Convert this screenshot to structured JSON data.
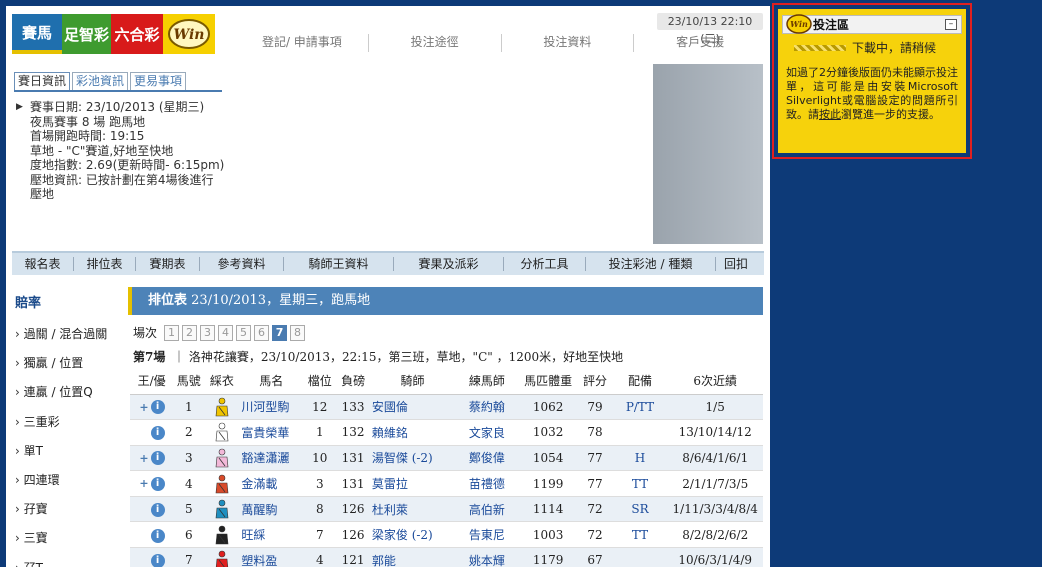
{
  "brand_tabs": [
    "賽馬",
    "足智彩",
    "六合彩",
    "Win"
  ],
  "datetime": "23/10/13 22:10 (三)",
  "top_links": [
    "登記/ 申請事項",
    "投注途徑",
    "投注資料",
    "客戶支援"
  ],
  "info_tabs": [
    "賽日資訊",
    "彩池資訊",
    "更易事項"
  ],
  "race_info_lines": [
    "賽事日期: 23/10/2013 (星期三)",
    "夜馬賽事 8 場 跑馬地",
    "首場開跑時間: 19:15",
    "草地 - \"C\"賽道,好地至快地",
    "度地指數: 2.69(更新時間- 6:15pm)",
    "壓地資訊: 已按計劃在第4場後進行",
    "壓地"
  ],
  "menu": [
    "報名表",
    "排位表",
    "賽期表",
    "參考資料",
    "騎師王資料",
    "賽果及派彩",
    "分析工具",
    "投注彩池 / 種類",
    "回扣"
  ],
  "left_nav": {
    "title": "賠率",
    "items": [
      "過關 / 混合過關",
      "獨贏 / 位置",
      "連贏 / 位置Q",
      "三重彩",
      "單T",
      "四連環",
      "孖寶",
      "三寶",
      "孖T"
    ]
  },
  "race_card": {
    "title_bold": "排位表",
    "title_rest": " 23/10/2013，星期三，跑馬地",
    "race_label": "場次",
    "races": [
      "1",
      "2",
      "3",
      "4",
      "5",
      "6",
      "7",
      "8"
    ],
    "active_race": "7",
    "race_no": "第7場",
    "race_desc": "洛神花讓賽，23/10/2013，22:15，第三班，草地，\"C\" ，1200米，好地至快地",
    "headers": [
      "王/優",
      "馬號",
      "綵衣",
      "馬名",
      "檔位",
      "負磅",
      "騎師",
      "練馬師",
      "馬匹體重",
      "評分",
      "配備",
      "6次近績"
    ],
    "rows": [
      {
        "plus": "+",
        "no": "1",
        "name": "川河型駒",
        "draw": "12",
        "wt": "133",
        "jockey": "安國倫",
        "trainer": "蔡約翰",
        "bw": "1062",
        "rating": "79",
        "gear": "P/TT",
        "form": "1/5"
      },
      {
        "plus": "",
        "no": "2",
        "name": "富貴榮華",
        "draw": "1",
        "wt": "132",
        "jockey": "賴維銘",
        "trainer": "文家良",
        "bw": "1032",
        "rating": "78",
        "gear": "",
        "form": "13/10/14/12"
      },
      {
        "plus": "+",
        "no": "3",
        "name": "豁達瀟灑",
        "draw": "10",
        "wt": "131",
        "jockey": "湯智傑 (-2)",
        "trainer": "鄭俊偉",
        "bw": "1054",
        "rating": "77",
        "gear": "H",
        "form": "8/6/4/1/6/1"
      },
      {
        "plus": "+",
        "no": "4",
        "name": "金滿載",
        "draw": "3",
        "wt": "131",
        "jockey": "莫雷拉",
        "trainer": "苗禮德",
        "bw": "1199",
        "rating": "77",
        "gear": "TT",
        "form": "2/1/1/7/3/5"
      },
      {
        "plus": "",
        "no": "5",
        "name": "萬醒駒",
        "draw": "8",
        "wt": "126",
        "jockey": "杜利萊",
        "trainer": "高伯新",
        "bw": "1114",
        "rating": "72",
        "gear": "SR",
        "form": "1/11/3/3/4/8/4"
      },
      {
        "plus": "",
        "no": "6",
        "name": "旺綵",
        "draw": "7",
        "wt": "126",
        "jockey": "梁家俊 (-2)",
        "trainer": "告東尼",
        "bw": "1003",
        "rating": "72",
        "gear": "TT",
        "form": "8/2/8/2/6/2"
      },
      {
        "plus": "",
        "no": "7",
        "name": "塑料盈",
        "draw": "4",
        "wt": "121",
        "jockey": "郭能",
        "trainer": "姚本輝",
        "bw": "1179",
        "rating": "67",
        "gear": "",
        "form": "10/6/3/1/4/9"
      }
    ]
  },
  "bet_panel": {
    "title": "投注區",
    "loading": "下載中，請稍候",
    "msg_before": "如過了2分鐘後版面仍未能顯示投注單，這可能是由安裝Microsoft Silverlight或電腦設定的問題所引致。請",
    "msg_link": "按此",
    "msg_after": "瀏覽進一步的支援。"
  },
  "silk_colors": [
    "#f0c400",
    "#ffffff",
    "#f2b8d8",
    "#d84a2a",
    "#1f8fc0",
    "#222222",
    "#e02020"
  ],
  "colors": {
    "brand_blue": "#1f6fae",
    "accent_yellow": "#f6d20c",
    "page_bg": "#0d3a78"
  }
}
